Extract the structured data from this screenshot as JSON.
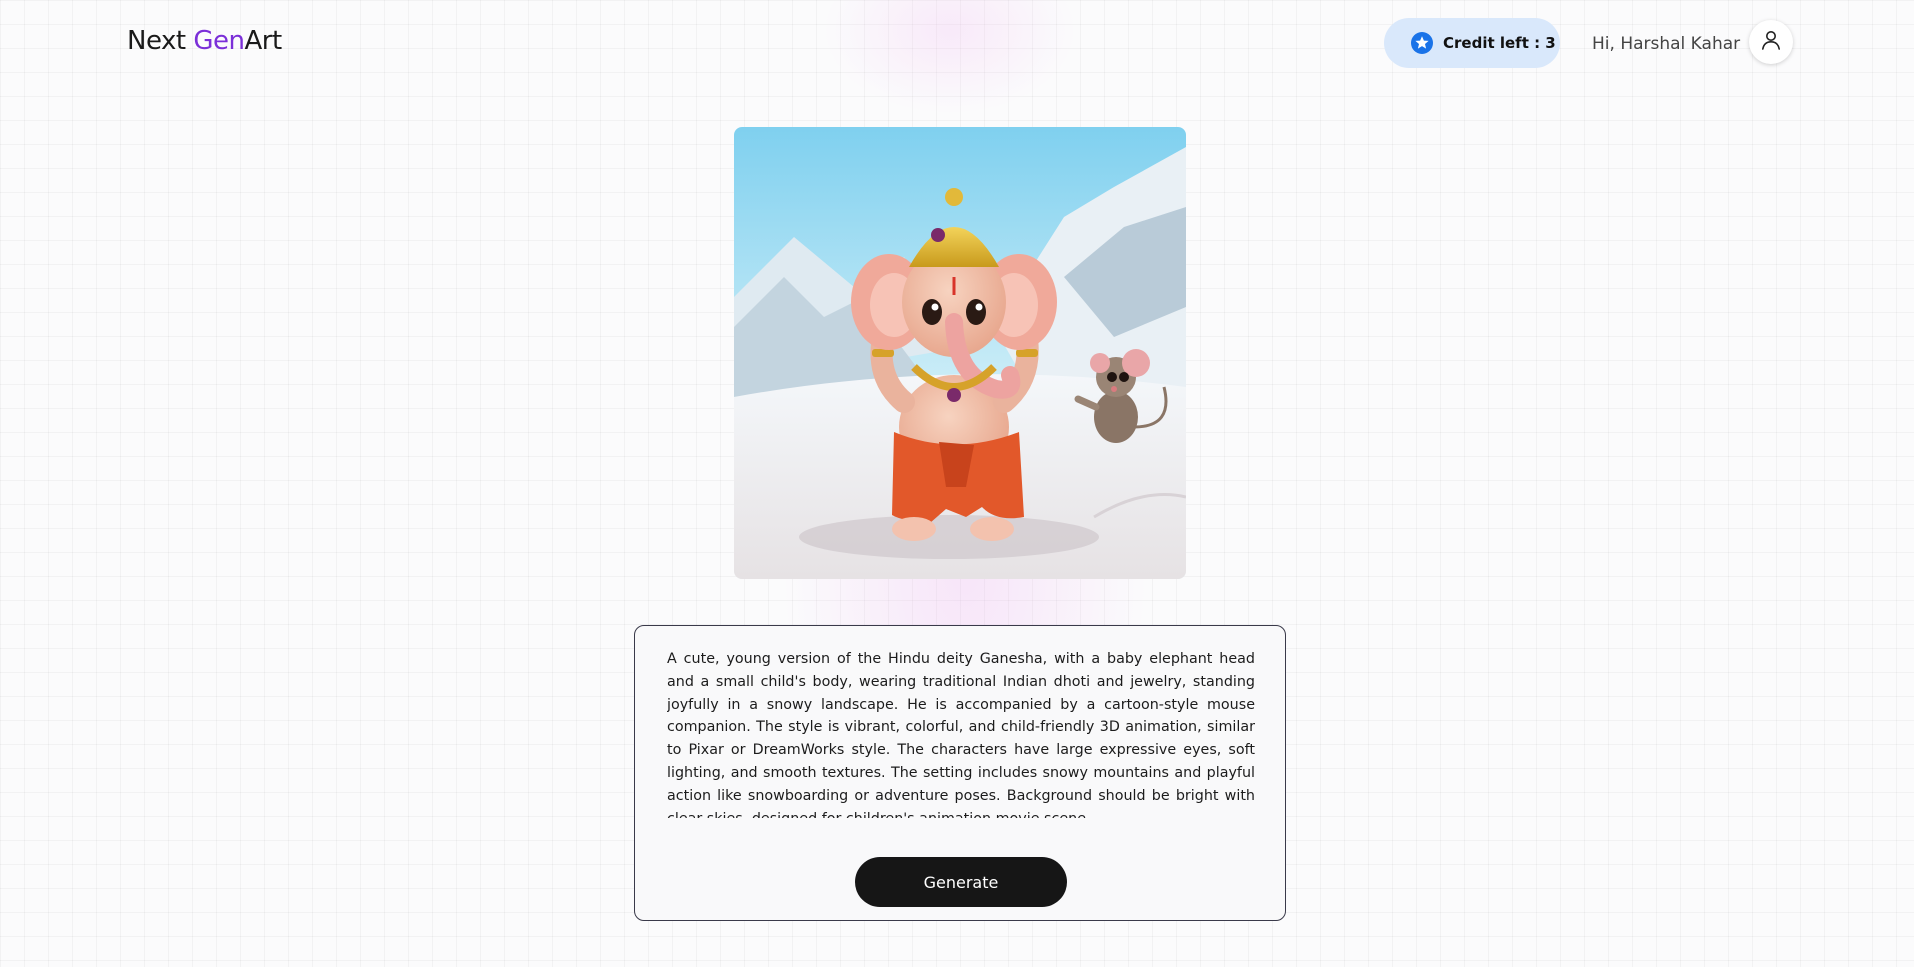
{
  "header": {
    "logo_part1": "Next ",
    "logo_part2": "Gen",
    "logo_part3": "Art",
    "credit_label": "Credit left : 3",
    "greeting": "Hi, Harshal Kahar"
  },
  "icons": {
    "credit": "star-badge-icon",
    "account": "user-icon"
  },
  "colors": {
    "brand_accent": "#7b2fd8",
    "credit_bg": "#d9e8fb",
    "star_icon": "#1a73e8",
    "button_bg": "#161616"
  },
  "prompt": {
    "value": "A cute, young version of the Hindu deity Ganesha, with a baby elephant head and a small child's body, wearing traditional Indian dhoti and jewelry, standing joyfully in a snowy landscape. He is accompanied by a cartoon-style mouse companion. The style is vibrant, colorful, and child-friendly 3D animation, similar to Pixar or DreamWorks style. The characters have large expressive eyes, soft lighting, and smooth textures. The setting includes snowy mountains and playful action like snowboarding or adventure poses. Background should be bright with clear skies, designed for children's animation movie scene."
  },
  "generate_label": "Generate"
}
